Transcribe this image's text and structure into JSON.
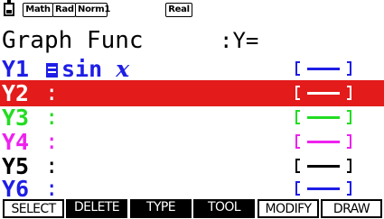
{
  "status_bar": {
    "battery_icon": "battery-icon",
    "modes": [
      "Math",
      "Rad",
      "Norm1"
    ],
    "number_mode": "Real"
  },
  "header": {
    "title": "Graph Func",
    "suffix": ":Y="
  },
  "functions": [
    {
      "label": "Y1",
      "expression_prefix": "sin ",
      "expression_var": "x",
      "selected": true,
      "label_color": "#1e1ee6",
      "line_color": "#1e1ee6",
      "highlighted": false
    },
    {
      "label": "Y2",
      "expression_prefix": "",
      "expression_var": "",
      "selected": false,
      "label_color": "#ffffff",
      "line_color": "#ffffff",
      "highlighted": true
    },
    {
      "label": "Y3",
      "expression_prefix": "",
      "expression_var": "",
      "selected": false,
      "label_color": "#22dd22",
      "line_color": "#22dd22",
      "highlighted": false
    },
    {
      "label": "Y4",
      "expression_prefix": "",
      "expression_var": "",
      "selected": false,
      "label_color": "#ee22ee",
      "line_color": "#ee22ee",
      "highlighted": false
    },
    {
      "label": "Y5",
      "expression_prefix": "",
      "expression_var": "",
      "selected": false,
      "label_color": "#000000",
      "line_color": "#000000",
      "highlighted": false
    },
    {
      "label": "Y6",
      "expression_prefix": "",
      "expression_var": "",
      "selected": false,
      "label_color": "#1e1ee6",
      "line_color": "#1e1ee6",
      "highlighted": false
    }
  ],
  "colors": {
    "highlight_row": "#e31b1b",
    "text": "#000000",
    "background": "#ffffff"
  },
  "function_keys": [
    {
      "label": "SELECT",
      "style": "outline"
    },
    {
      "label": "DELETE",
      "style": "dark"
    },
    {
      "label": "TYPE",
      "style": "dark"
    },
    {
      "label": "TOOL",
      "style": "dark"
    },
    {
      "label": "MODIFY",
      "style": "outline"
    },
    {
      "label": "DRAW",
      "style": "outline"
    }
  ]
}
